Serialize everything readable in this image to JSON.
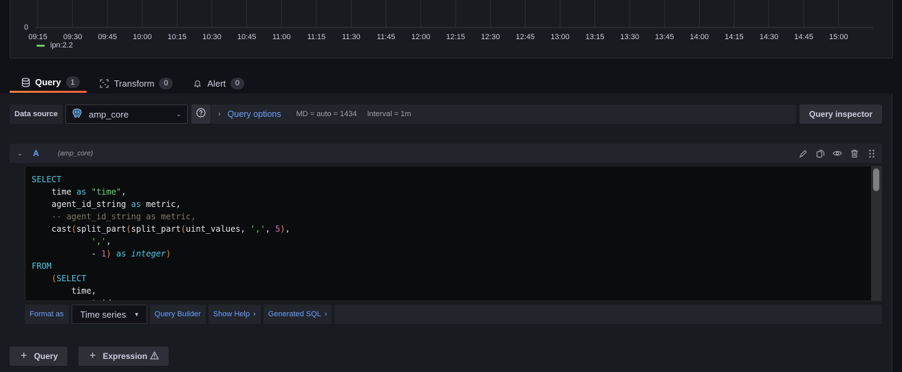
{
  "graph": {
    "y_zero_label": "0",
    "time_ticks": [
      "09:15",
      "09:30",
      "09:45",
      "10:00",
      "10:15",
      "10:30",
      "10:45",
      "11:00",
      "11:15",
      "11:30",
      "11:45",
      "12:00",
      "12:15",
      "12:30",
      "12:45",
      "13:00",
      "13:15",
      "13:30",
      "13:45",
      "14:00",
      "14:15",
      "14:30",
      "14:45",
      "15:00"
    ],
    "legend": [
      {
        "label": "ipn:2.2",
        "color": "#73bf69"
      }
    ]
  },
  "tabs": [
    {
      "label": "Query",
      "count": "1",
      "icon": "database-icon",
      "active": true
    },
    {
      "label": "Transform",
      "count": "0",
      "icon": "transform-icon",
      "active": false
    },
    {
      "label": "Alert",
      "count": "0",
      "icon": "bell-icon",
      "active": false
    }
  ],
  "datasource": {
    "label": "Data source",
    "selected": "amp_core",
    "icon": "postgresql-icon"
  },
  "query_options": {
    "title": "Query options",
    "md": "MD = auto = 1434",
    "interval": "Interval = 1m"
  },
  "query_inspector_label": "Query inspector",
  "query": {
    "ref_id": "A",
    "datasource_name": "(amp_core)",
    "actions": [
      "edit-icon",
      "duplicate-icon",
      "eye-icon",
      "trash-icon",
      "drag-handle-icon"
    ]
  },
  "format": {
    "label": "Format as",
    "selected": "Time series",
    "query_builder": "Query Builder",
    "show_help": "Show Help",
    "generated_sql": "Generated SQL"
  },
  "add_buttons": {
    "query": "Query",
    "expression": "Expression"
  },
  "accent": {
    "tab_underline": "#f55f3e",
    "link_blue": "#6e9fff",
    "series_green": "#73bf69"
  }
}
